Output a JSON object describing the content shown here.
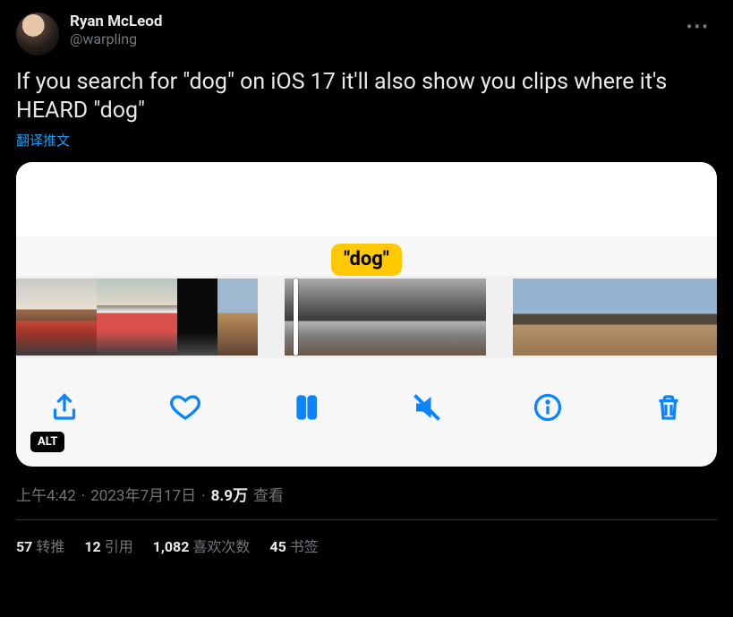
{
  "user": {
    "display_name": "Ryan McLeod",
    "handle": "@warpling"
  },
  "tweet": {
    "text": "If you search for \"dog\" on iOS 17 it'll also show you clips where it's HEARD \"dog\"",
    "translate_label": "翻译推文"
  },
  "media": {
    "caption_bubble": "\"dog\"",
    "alt_badge": "ALT",
    "toolbar": {
      "share": "share-icon",
      "like": "heart-icon",
      "pause": "pause-icon",
      "mute": "mute-icon",
      "info": "info-icon",
      "trash": "trash-icon"
    }
  },
  "meta": {
    "time": "上午4:42",
    "date": "2023年7月17日",
    "views_count": "8.9万",
    "views_label": "查看"
  },
  "stats": {
    "retweets": {
      "count": "57",
      "label": "转推"
    },
    "quotes": {
      "count": "12",
      "label": "引用"
    },
    "likes": {
      "count": "1,082",
      "label": "喜欢次数"
    },
    "bookmarks": {
      "count": "45",
      "label": "书签"
    }
  }
}
